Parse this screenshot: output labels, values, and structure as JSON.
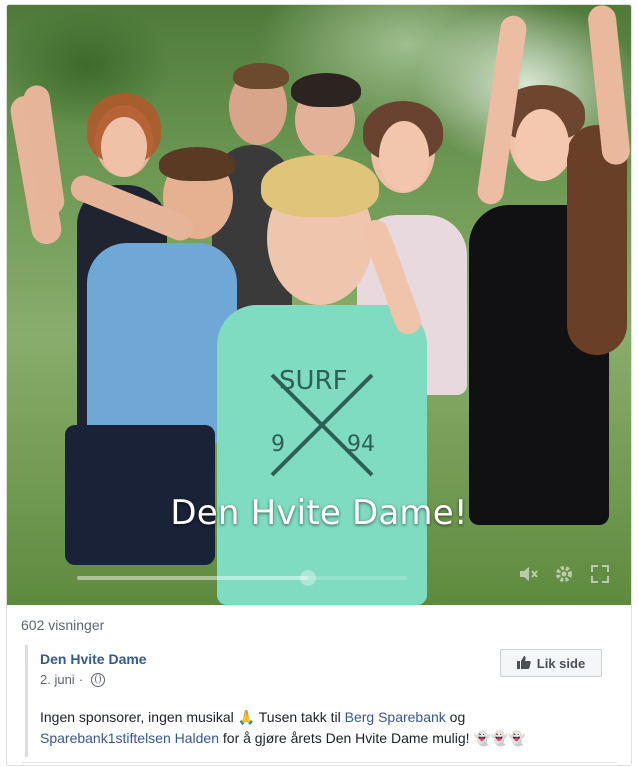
{
  "video": {
    "caption": "Den Hvite Dame!",
    "controls": {
      "mute_icon": "mute-icon",
      "settings_icon": "gear-icon",
      "fullscreen_icon": "fullscreen-icon"
    },
    "progress_fraction": 0.7
  },
  "views_text": "602 visninger",
  "shared_post": {
    "page_name": "Den Hvite Dame",
    "date": "2. juni",
    "date_separator": "·",
    "privacy_icon": "globe-icon",
    "like_button_label": "Lik side",
    "text_part1": "Ingen sponsorer, ingen musikal",
    "emoji_pray": "🙏",
    "text_part2": " Tusen takk til ",
    "link1": "Berg Sparebank",
    "text_part3": " og ",
    "link2": "Sparebank1stiftelsen Halden",
    "text_part4": " for å gjøre årets Den Hvite Dame mulig!",
    "emoji_ghosts": "👻👻👻"
  },
  "colors": {
    "link": "#365899",
    "muted": "#606770",
    "text": "#1d2129"
  }
}
